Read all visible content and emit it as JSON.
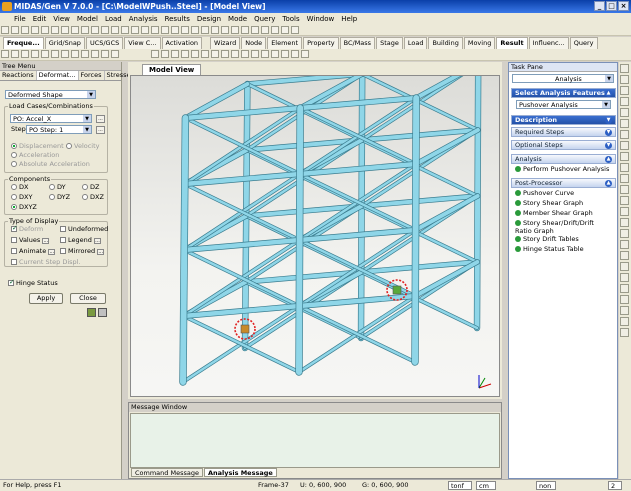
{
  "title": "MIDAS/Gen V 7.0.0 - [C:\\ModelWPush..Steel] - [Model View]",
  "menu": [
    "File",
    "Edit",
    "View",
    "Model",
    "Load",
    "Analysis",
    "Results",
    "Design",
    "Mode",
    "Query",
    "Tools",
    "Window",
    "Help"
  ],
  "ribbon_tabs_left": [
    "Freque...",
    "Grid/Snap",
    "UCS/GCS",
    "View C...",
    "Activation"
  ],
  "ribbon_tabs_right": [
    "Wizard",
    "Node",
    "Element",
    "Property",
    "BC/Mass",
    "Stage",
    "Load",
    "Building",
    "Moving",
    "Result",
    "Influenc...",
    "Query"
  ],
  "tree_menu": {
    "title": "Tree Menu",
    "tabs": [
      "Reactions",
      "Deformat...",
      "Forces",
      "Stresses"
    ],
    "shape_select": "Deformed Shape",
    "load_cases_label": "Load Cases/Combinations",
    "load_case_value": "PO: Accel_X",
    "step_label": "Step",
    "step_value": "PO Step: 1",
    "results": [
      "Displacement",
      "Velocity",
      "Acceleration",
      "Absolute Acceleration"
    ],
    "components_label": "Components",
    "components": [
      "DX",
      "DY",
      "DZ",
      "DXY",
      "DYZ",
      "DXZ",
      "DXYZ"
    ],
    "display_label": "Type of Display",
    "display_opts": [
      "Deform",
      "Undeformed",
      "Values",
      "Legend",
      "Animate",
      "Mirrored",
      "Current Step Displ."
    ],
    "hinge_status": "Hinge Status",
    "apply": "Apply",
    "close": "Close"
  },
  "view_tab": "Model View",
  "task_pane": {
    "title": "Task Pane",
    "dropdown": "Analysis",
    "select_feature": "Select Analysis Features",
    "feature_value": "Pushover Analysis",
    "description": "Description",
    "required": "Required Steps",
    "optional": "Optional Steps",
    "analysis": "Analysis",
    "analysis_items": [
      "Perform Pushover Analysis"
    ],
    "post": "Post-Processor",
    "post_items": [
      "Pushover Curve",
      "Story Shear Graph",
      "Member Shear Graph",
      "Story Shear/Drift/Drift Ratio Graph",
      "Story Drift Tables",
      "Hinge Status Table"
    ]
  },
  "message_window": {
    "title": "Message Window",
    "tabs": [
      "Command Message",
      "Analysis Message"
    ]
  },
  "status": {
    "help": "For Help, press F1",
    "frame": "Frame-37",
    "u": "U: 0, 600, 900",
    "g": "G: 0, 600, 900",
    "force_unit": "tonf",
    "length_unit": "cm",
    "extra": "non",
    "page": "2"
  },
  "colors": {
    "member": "#8fd6e8",
    "member_edge": "#3c7e90",
    "hinge_marker": "#e02020"
  }
}
